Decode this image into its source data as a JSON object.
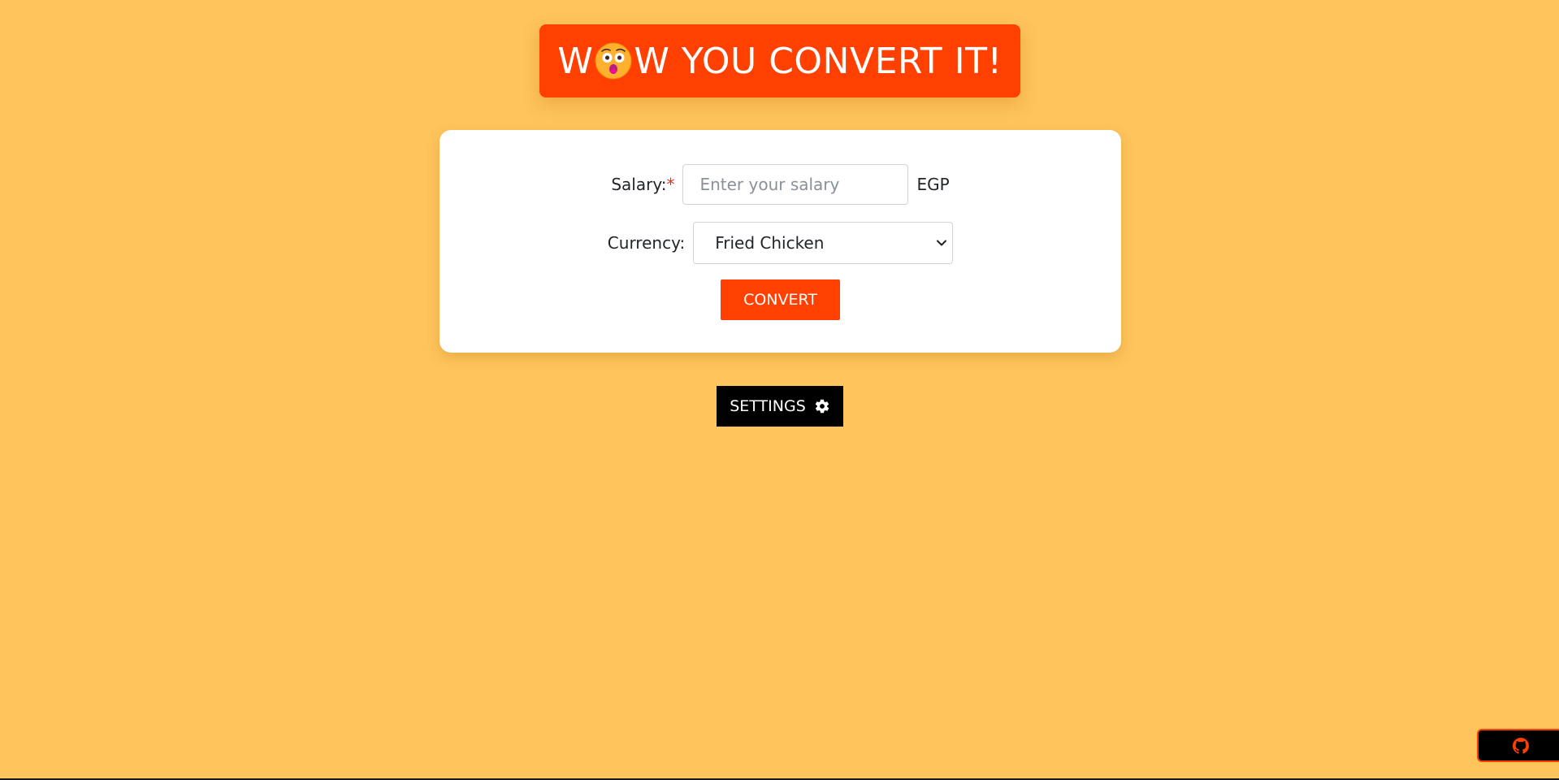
{
  "header": {
    "title_before": "W",
    "title_after": "W YOU CONVERT IT!",
    "emoji": "astonished-face-emoji"
  },
  "form": {
    "salary_label": "Salary:",
    "required_mark": "*",
    "salary_placeholder": "Enter your salary",
    "salary_value": "",
    "salary_unit": "EGP",
    "currency_label": "Currency:",
    "currency_selected": "Fried Chicken",
    "convert_label": "CONVERT"
  },
  "settings": {
    "label": "SETTINGS",
    "icon": "gear-icon"
  },
  "footer": {
    "github_icon": "github-icon"
  },
  "colors": {
    "background": "#ffc45c",
    "accent": "#ff4000",
    "dark": "#000000",
    "card": "#ffffff"
  }
}
